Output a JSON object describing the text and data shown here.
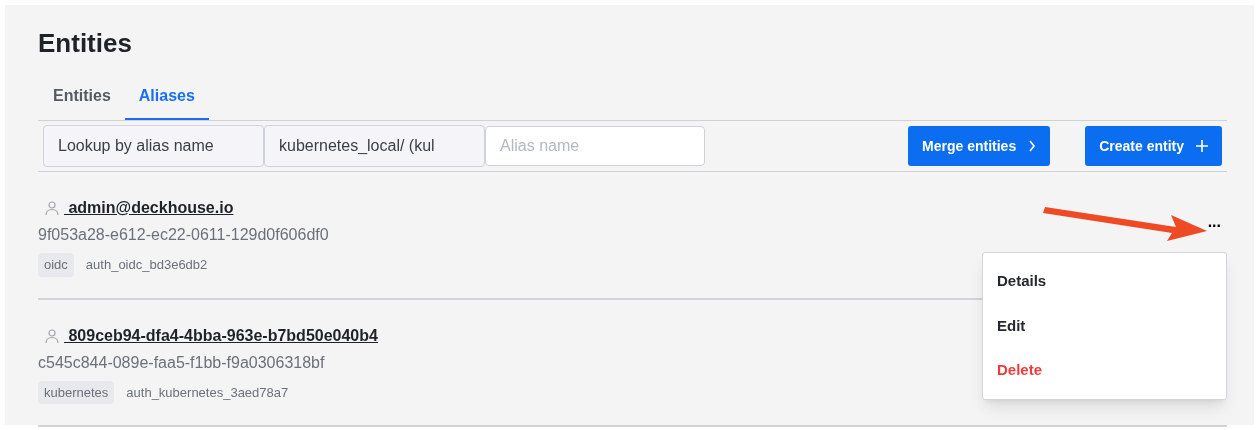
{
  "title": "Entities",
  "tabs": [
    {
      "label": "Entities",
      "selected": false
    },
    {
      "label": "Aliases",
      "selected": true
    }
  ],
  "toolbar": {
    "lookup_mode": "Lookup by alias name",
    "mount": "kubernetes_local/ (kul",
    "alias_field": {
      "placeholder": "Alias name"
    },
    "buttons": [
      {
        "label": "Merge entities",
        "kind": "chevron"
      },
      {
        "label": "Create entity",
        "kind": "plus"
      }
    ]
  },
  "rows": [
    {
      "name": " admin@deckhouse.io",
      "id": "9f053a28-e612-ec22-0611-129d0f606df0",
      "tag": "oidc",
      "mount": "auth_oidc_bd3e6db2",
      "more": "..."
    },
    {
      "name": " 809ceb94-dfa4-4bba-963e-b7bd50e040b4",
      "id": "c545c844-089e-faa5-f1bb-f9a0306318bf",
      "tag": "kubernetes",
      "mount": "auth_kubernetes_3aed78a7"
    }
  ],
  "menu": [
    {
      "label": "Details",
      "kind": "normal"
    },
    {
      "label": "Edit",
      "kind": "normal"
    },
    {
      "label": "Delete",
      "kind": "danger"
    }
  ]
}
